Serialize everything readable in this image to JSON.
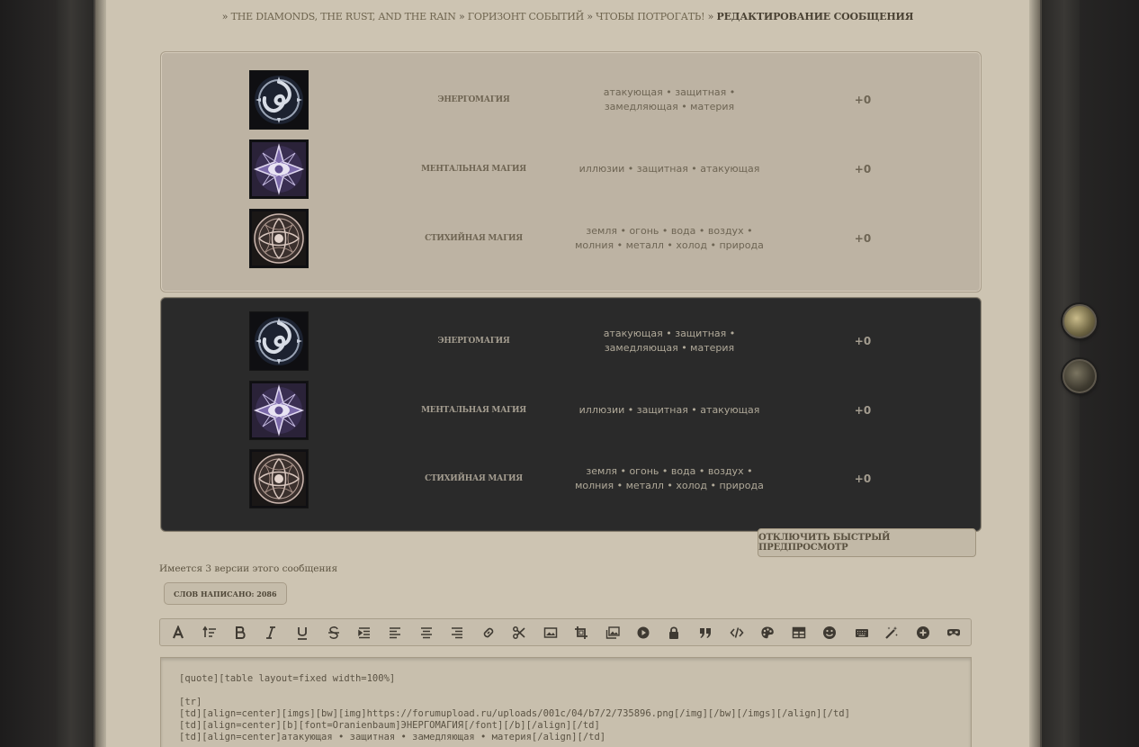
{
  "breadcrumb": {
    "items": [
      "THE DIAMONDS, THE RUST, AND THE RAIN",
      "ГОРИЗОНТ СОБЫТИЙ",
      "ЧТОБЫ ПОТРОГАТЬ!"
    ],
    "current": "РЕДАКТИРОВАНИЕ СООБЩЕНИЯ",
    "separator": "»"
  },
  "skills_light": [
    {
      "name": "ЭНЕРГОМАГИЯ",
      "desc_line1": "атакующая • защитная •",
      "desc_line2": "замедляющая • материя",
      "bonus": "+0",
      "icon": "energy-magic-icon"
    },
    {
      "name": "МЕНТАЛЬНАЯ МАГИЯ",
      "desc_line1": "иллюзии • защитная • атакующая",
      "desc_line2": "",
      "bonus": "+0",
      "icon": "mental-magic-icon"
    },
    {
      "name": "СТИХИЙНАЯ МАГИЯ",
      "desc_line1": "земля • огонь • вода • воздух •",
      "desc_line2": "молния • металл • холод • природа",
      "bonus": "+0",
      "icon": "elemental-magic-icon"
    }
  ],
  "skills_dark": [
    {
      "name": "ЭНЕРГОМАГИЯ",
      "desc_line1": "атакующая • защитная •",
      "desc_line2": "замедляющая • материя",
      "bonus": "+0",
      "icon": "energy-magic-icon"
    },
    {
      "name": "МЕНТАЛЬНАЯ МАГИЯ",
      "desc_line1": "иллюзии • защитная • атакующая",
      "desc_line2": "",
      "bonus": "+0",
      "icon": "mental-magic-icon"
    },
    {
      "name": "СТИХИЙНАЯ МАГИЯ",
      "desc_line1": "земля • огонь • вода • воздух •",
      "desc_line2": "молния • металл • холод • природа",
      "bonus": "+0",
      "icon": "elemental-magic-icon"
    }
  ],
  "preview_button": "ОТКЛЮЧИТЬ БЫСТРЫЙ ПРЕДПРОСМОТР",
  "versions_text": "Имеется 3 версии этого сообщения",
  "words_badge": "СЛОВ НАПИСАНО: 2086",
  "toolbar": [
    {
      "icon": "font-icon",
      "glyph": "A"
    },
    {
      "icon": "font-size-icon",
      "glyph": "size"
    },
    {
      "icon": "bold-icon",
      "glyph": "B"
    },
    {
      "icon": "italic-icon",
      "glyph": "I"
    },
    {
      "icon": "underline-icon",
      "glyph": "U"
    },
    {
      "icon": "strikethrough-icon",
      "glyph": "S"
    },
    {
      "icon": "indent-icon",
      "glyph": "indent"
    },
    {
      "icon": "align-left-icon",
      "glyph": "left"
    },
    {
      "icon": "align-center-icon",
      "glyph": "center"
    },
    {
      "icon": "align-right-icon",
      "glyph": "right"
    },
    {
      "icon": "link-icon",
      "glyph": "link"
    },
    {
      "icon": "scissors-icon",
      "glyph": "cut"
    },
    {
      "icon": "image-icon",
      "glyph": "image"
    },
    {
      "icon": "crop-icon",
      "glyph": "crop"
    },
    {
      "icon": "gallery-icon",
      "glyph": "gallery"
    },
    {
      "icon": "video-icon",
      "glyph": "play"
    },
    {
      "icon": "lock-icon",
      "glyph": "lock"
    },
    {
      "icon": "quote-icon",
      "glyph": "quote"
    },
    {
      "icon": "code-icon",
      "glyph": "code"
    },
    {
      "icon": "palette-icon",
      "glyph": "palette"
    },
    {
      "icon": "table-icon",
      "glyph": "table"
    },
    {
      "icon": "smiley-icon",
      "glyph": "smile"
    },
    {
      "icon": "keyboard-icon",
      "glyph": "keyboard"
    },
    {
      "icon": "magic-wand-icon",
      "glyph": "wand"
    },
    {
      "icon": "add-icon",
      "glyph": "plus"
    },
    {
      "icon": "mask-icon",
      "glyph": "mask"
    }
  ],
  "editor_lines": [
    "[quote][table layout=fixed width=100%]",
    "",
    "[tr]",
    "[td][align=center][imgs][bw][img]https://forumupload.ru/uploads/001c/04/b7/2/735896.png[/img][/bw][/imgs][/align][/td]",
    "[td][align=center][b][font=Oranienbaum]ЭНЕРГОМАГИЯ[/font][/b][/align][/td]",
    "[td][align=center]атакующая • защитная • замедляющая • материя[/align][/td]"
  ]
}
